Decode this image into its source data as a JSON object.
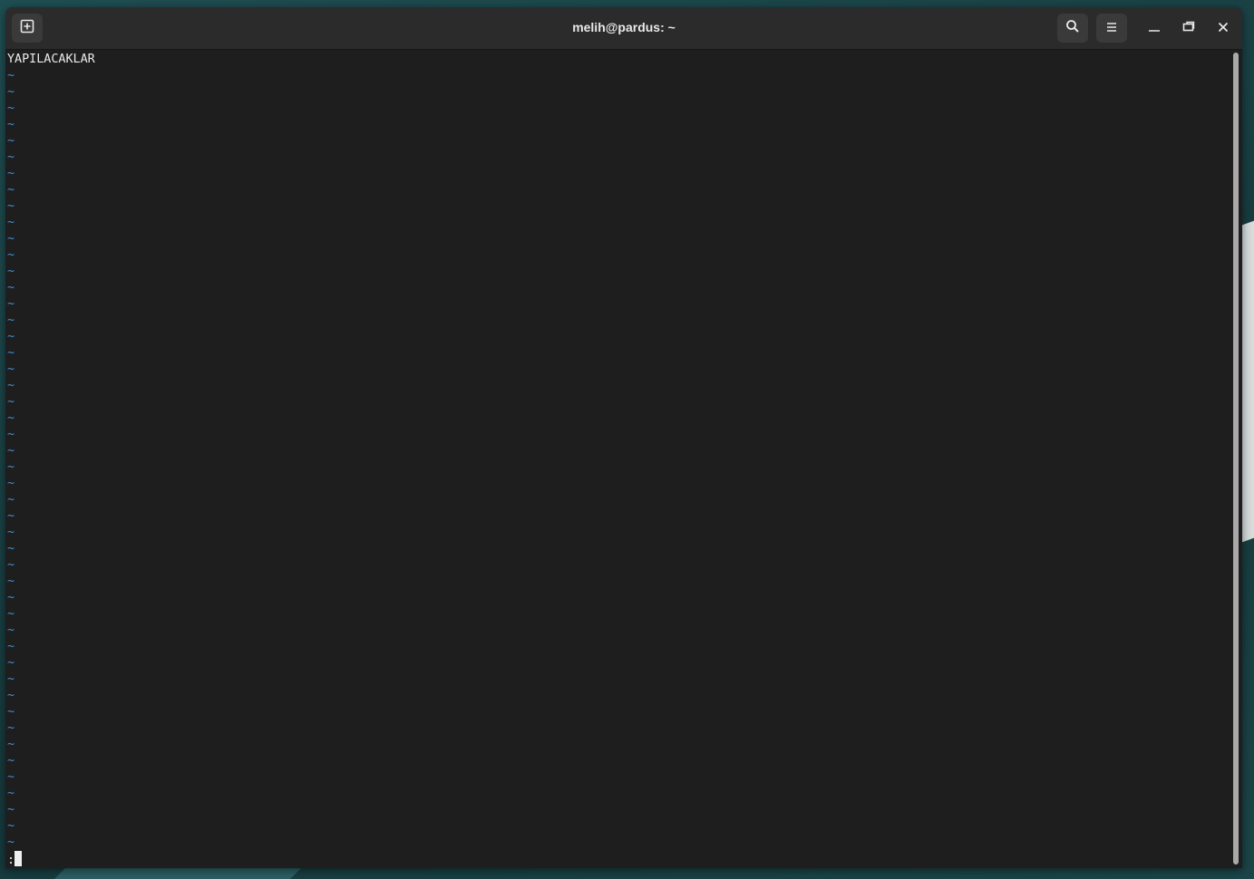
{
  "window": {
    "title": "melih@pardus: ~"
  },
  "icons": {
    "new_tab": "new-tab-icon",
    "search": "search-icon",
    "menu": "hamburger-menu-icon",
    "minimize": "minimize-icon",
    "maximize": "maximize-icon",
    "close": "close-icon"
  },
  "terminal": {
    "first_line": "YAPILACAKLAR",
    "empty_line_marker": "~",
    "empty_line_count": 48,
    "command_prompt": ":"
  },
  "colors": {
    "terminal_bg": "#1e1e1e",
    "tilde": "#3f8fd8",
    "text": "#e9e9e9",
    "titlebar": "#2b2b2b"
  }
}
